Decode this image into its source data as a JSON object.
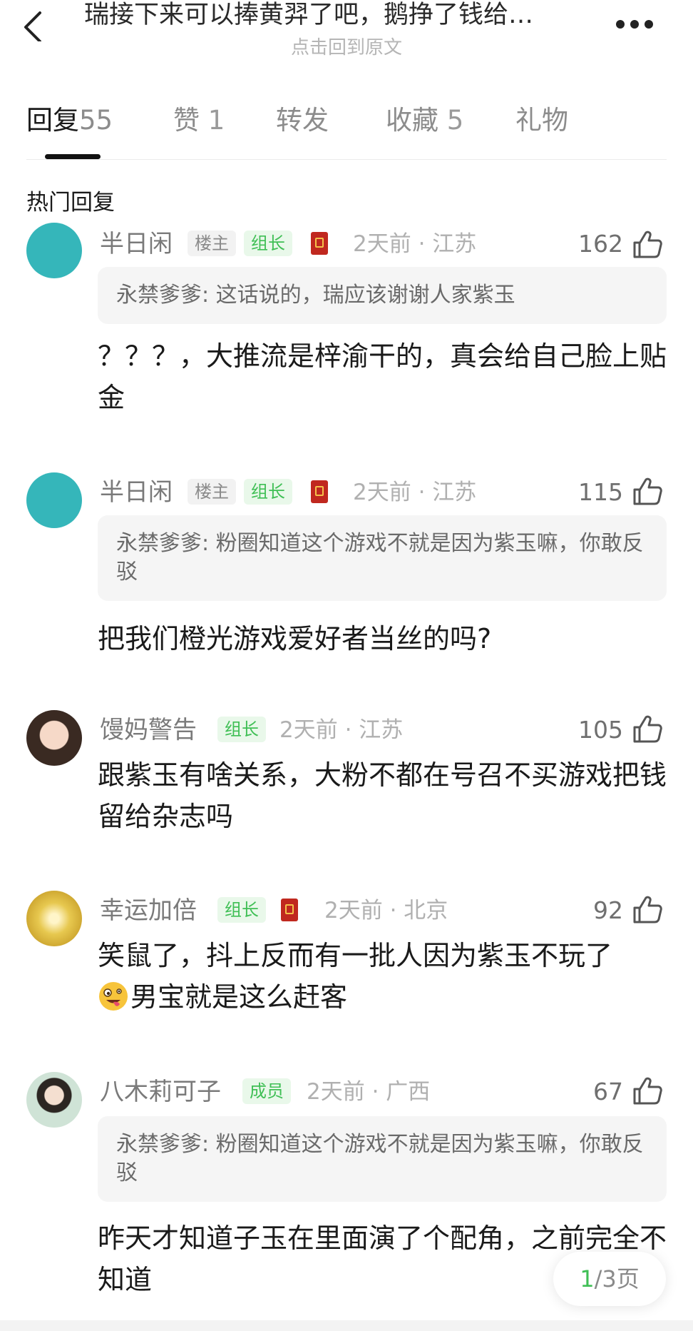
{
  "header": {
    "title": "瑞接下来可以捧黄羿了吧，鹅挣了钱给…",
    "subtitle": "点击回到原文"
  },
  "tabs": [
    {
      "label": "回复",
      "count": "55"
    },
    {
      "label": "赞",
      "count": "1"
    },
    {
      "label": "转发",
      "count": ""
    },
    {
      "label": "收藏",
      "count": "5"
    },
    {
      "label": "礼物",
      "count": ""
    }
  ],
  "section_title": "热门回复",
  "comments": [
    {
      "user": "半日闲",
      "badges": [
        "楼主",
        "组长"
      ],
      "time_loc": "2天前 · 江苏",
      "likes": "162",
      "quote": "永禁爹爹: 这话说的，瑞应该谢谢人家紫玉",
      "text": "？？？，大推流是梓渝干的，真会给自己脸上贴金"
    },
    {
      "user": "半日闲",
      "badges": [
        "楼主",
        "组长"
      ],
      "time_loc": "2天前 · 江苏",
      "likes": "115",
      "quote": "永禁爹爹: 粉圈知道这个游戏不就是因为紫玉嘛，你敢反驳",
      "text": "把我们橙光游戏爱好者当丝的吗?"
    },
    {
      "user": "馒妈警告",
      "badges": [
        "组长"
      ],
      "time_loc": "2天前 · 江苏",
      "likes": "105",
      "quote": "",
      "text": "跟紫玉有啥关系，大粉不都在号召不买游戏把钱留给杂志吗"
    },
    {
      "user": "幸运加倍",
      "badges": [
        "组长"
      ],
      "time_loc": "2天前 · 北京",
      "likes": "92",
      "quote": "",
      "text_line1": "笑鼠了，抖上反而有一批人因为紫玉不玩了",
      "text_line2": "男宝就是这么赶客"
    },
    {
      "user": "八木莉可子",
      "badges": [
        "成员"
      ],
      "time_loc": "2天前 · 广西",
      "likes": "67",
      "quote": "永禁爹爹: 粉圈知道这个游戏不就是因为紫玉嘛，你敢反驳",
      "text": "昨天才知道子玉在里面演了个配角，之前完全不知道"
    }
  ],
  "pager": {
    "current": "1",
    "total_label": "/3页"
  },
  "colors": {
    "accent_green": "#3fbf55",
    "avatar_teal": "#35b6ba"
  }
}
